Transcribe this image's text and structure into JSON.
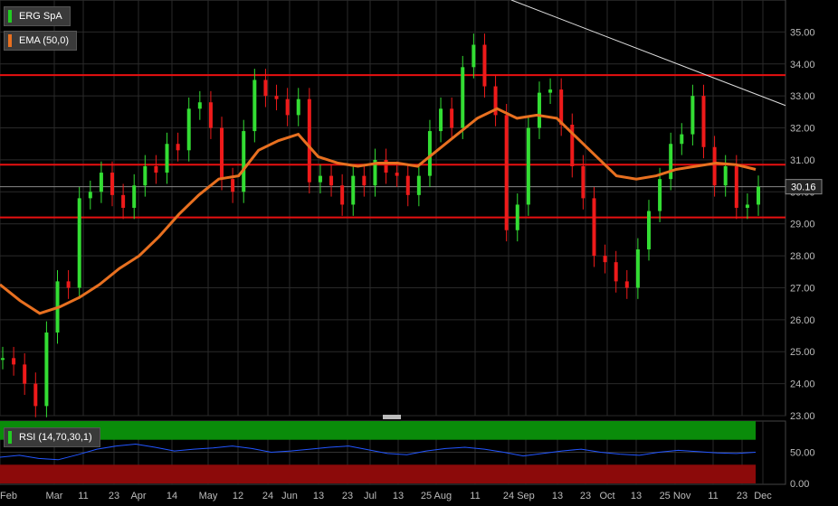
{
  "legend": {
    "main": {
      "label": "ERG SpA",
      "color": "#22cc22"
    },
    "ema": {
      "label": "EMA (50,0)",
      "color": "#e87020"
    },
    "rsi": {
      "label": "RSI (14,70,30,1)",
      "color": "#22cc22"
    }
  },
  "price_badge": "30.16",
  "chart_data": {
    "type": "candlestick",
    "title": "ERG SpA",
    "price_axis": {
      "ylim": [
        23.0,
        36.0
      ],
      "ticks": [
        "35.00",
        "34.00",
        "33.00",
        "32.00",
        "31.00",
        "30.00",
        "29.00",
        "28.00",
        "27.00",
        "26.00",
        "25.00",
        "24.00",
        "23.00"
      ]
    },
    "rsi_axis": {
      "ylim": [
        0,
        100
      ],
      "ticks": [
        "50.00",
        "0.00"
      ]
    },
    "x_labels": [
      "Feb",
      "Mar",
      "11",
      "23",
      "Apr",
      "14",
      "May",
      "12",
      "24",
      "Jun",
      "13",
      "23",
      "Jul",
      "13",
      "25 Aug",
      "11",
      "24",
      "Sep",
      "13",
      "23",
      "Oct",
      "13",
      "25 Nov",
      "11",
      "23",
      "Dec"
    ],
    "last_price": 30.16,
    "horizontal_levels": [
      33.65,
      30.85,
      29.2
    ],
    "trendline": {
      "from": {
        "x": "24",
        "y": 36.0
      },
      "to": {
        "x": "Dec",
        "y": 32.7
      }
    },
    "close_series": [
      24.8,
      24.6,
      24.0,
      23.3,
      25.6,
      27.2,
      27.0,
      29.8,
      30.0,
      30.6,
      29.9,
      29.5,
      30.2,
      30.8,
      30.6,
      31.5,
      31.3,
      32.6,
      32.8,
      32.0,
      30.4,
      30.0,
      31.9,
      33.5,
      33.0,
      32.9,
      32.4,
      32.9,
      30.3,
      30.5,
      30.2,
      29.6,
      30.5,
      30.2,
      31.0,
      30.6,
      30.5,
      29.9,
      30.5,
      31.9,
      32.6,
      32.0,
      33.9,
      34.6,
      33.3,
      32.4,
      28.8,
      29.6,
      32.0,
      33.1,
      33.2,
      32.1,
      30.8,
      29.8,
      28.0,
      27.8,
      27.2,
      27.0,
      28.2,
      29.4,
      30.4,
      31.5,
      31.8,
      33.0,
      31.4,
      30.2,
      30.8,
      29.5,
      29.6,
      30.16
    ],
    "ema_series": [
      27.1,
      26.6,
      26.2,
      26.4,
      26.7,
      27.1,
      27.6,
      28.0,
      28.6,
      29.3,
      29.9,
      30.4,
      30.5,
      31.3,
      31.6,
      31.8,
      31.1,
      30.9,
      30.8,
      30.9,
      30.9,
      30.8,
      31.3,
      31.8,
      32.3,
      32.6,
      32.3,
      32.4,
      32.3,
      31.7,
      31.1,
      30.5,
      30.4,
      30.5,
      30.7,
      30.8,
      30.9,
      30.85,
      30.7
    ],
    "rsi_series": [
      42,
      45,
      40,
      38,
      46,
      55,
      60,
      63,
      58,
      52,
      55,
      57,
      60,
      56,
      50,
      52,
      55,
      58,
      60,
      54,
      48,
      46,
      52,
      56,
      58,
      55,
      50,
      44,
      48,
      52,
      55,
      50,
      47,
      45,
      50,
      53,
      51,
      49,
      48,
      50
    ],
    "rsi_bands": {
      "overbought": 70,
      "oversold": 30
    }
  }
}
